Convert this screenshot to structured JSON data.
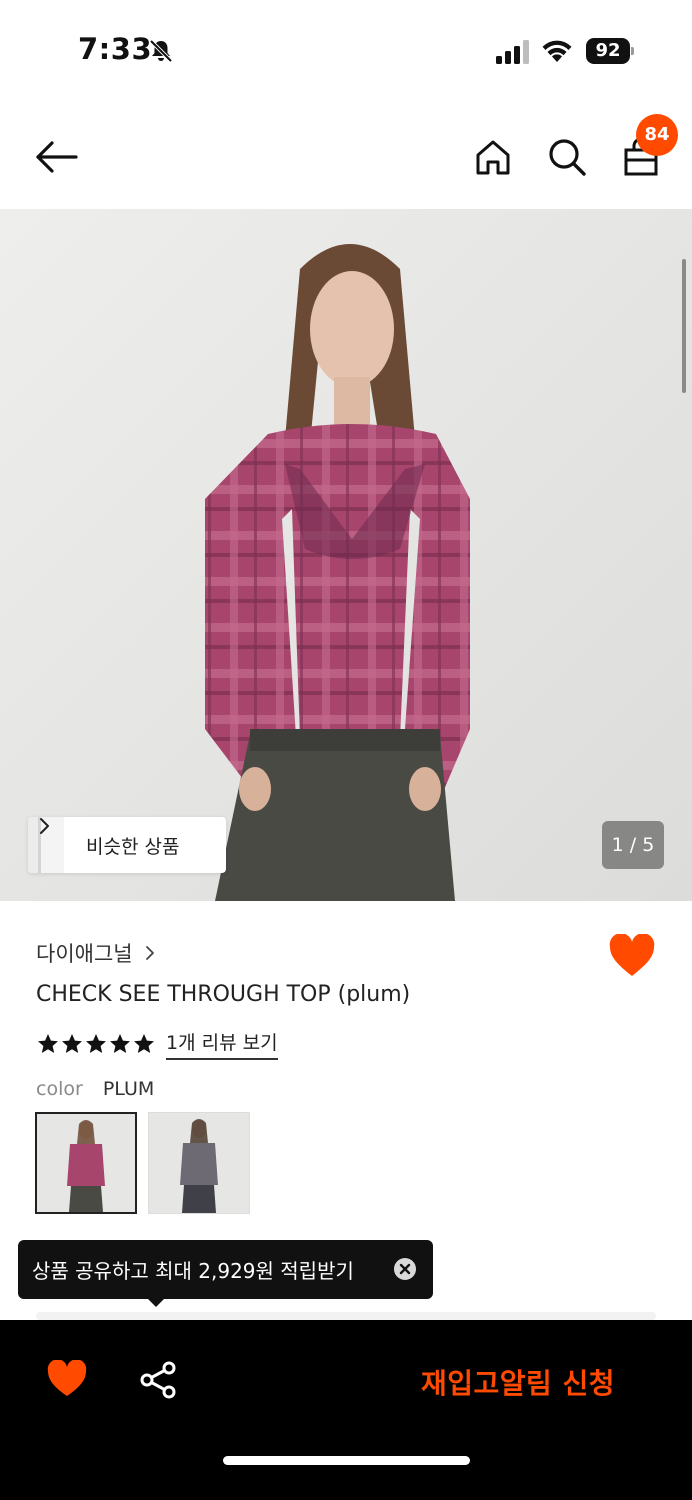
{
  "status_bar": {
    "time": "7:33",
    "battery": "92",
    "icons": [
      "bell-slash-icon",
      "signal-icon",
      "wifi-icon",
      "battery-icon"
    ]
  },
  "nav": {
    "icons": [
      "back-arrow-icon",
      "home-icon",
      "search-icon",
      "shopping-bag-icon"
    ],
    "bag_badge_count": "84"
  },
  "hero": {
    "similar_products_label": "비슷한 상품",
    "page_counter": "1 / 5"
  },
  "product": {
    "brand": "다이애그널",
    "name": "CHECK SEE THROUGH TOP (plum)",
    "rating_stars": 5,
    "review_link": "1개 리뷰 보기",
    "color_label": "color",
    "color_value": "PLUM",
    "swatch_count": 2
  },
  "tooltip": {
    "text": "상품 공유하고 최대 2,929원 적립받기"
  },
  "bottom_bar": {
    "icons": [
      "heart-icon",
      "share-icon"
    ],
    "restock_label": "재입고알림 신청"
  },
  "colors": {
    "accent": "#ff4a00",
    "plum": "#a8456d",
    "dark": "#111111"
  }
}
